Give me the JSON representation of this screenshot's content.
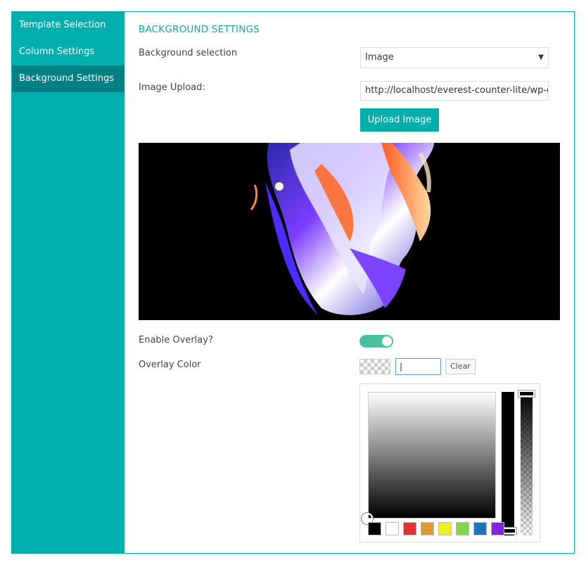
{
  "sidebar": {
    "items": [
      {
        "label": "Template Selection",
        "active": false
      },
      {
        "label": "Column Settings",
        "active": false
      },
      {
        "label": "Background Settings",
        "active": true
      }
    ]
  },
  "main": {
    "section_title": "BACKGROUND SETTINGS",
    "background_selection": {
      "label": "Background selection",
      "value": "Image"
    },
    "image_upload": {
      "label": "Image Upload:",
      "value": "http://localhost/everest-counter-lite/wp-c",
      "button_label": "Upload Image"
    },
    "overlay": {
      "label": "Enable Overlay?",
      "enabled": true
    },
    "overlay_color": {
      "label": "Overlay Color",
      "hex_value": "|",
      "clear_label": "Clear",
      "palette": [
        "#000000",
        "#ffffff",
        "#dd3333",
        "#dd9933",
        "#eeee22",
        "#81d742",
        "#1e73be",
        "#8224e3"
      ]
    }
  },
  "colors": {
    "accent": "#00aeae",
    "accent_dark": "#008082",
    "toggle_on": "#45c29b"
  }
}
